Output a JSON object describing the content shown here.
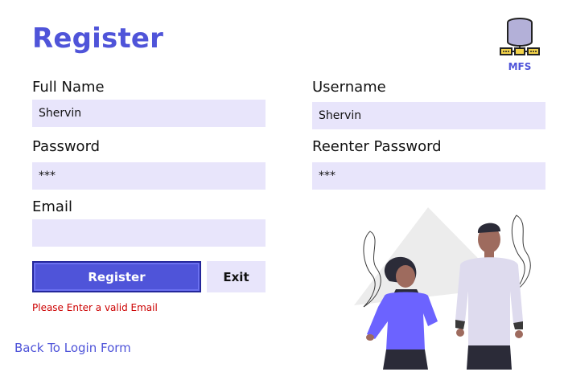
{
  "page": {
    "title": "Register"
  },
  "logo": {
    "text": "MFS",
    "icon": "database-server-icon"
  },
  "form": {
    "full_name": {
      "label": "Full Name",
      "value": "Shervin",
      "placeholder": ""
    },
    "username": {
      "label": "Username",
      "value": "Shervin",
      "placeholder": ""
    },
    "password": {
      "label": "Password",
      "value": "***",
      "placeholder": ""
    },
    "reenter_password": {
      "label": "Reenter Password",
      "value": "***",
      "placeholder": ""
    },
    "email": {
      "label": "Email",
      "value": "",
      "placeholder": ""
    }
  },
  "buttons": {
    "register_label": "Register",
    "exit_label": "Exit"
  },
  "messages": {
    "error": "Please Enter a valid Email"
  },
  "links": {
    "back_to_login": "Back To Login Form"
  },
  "colors": {
    "accent": "#4f54d9",
    "field_bg": "#e8e5fb",
    "error": "#cc0000"
  }
}
